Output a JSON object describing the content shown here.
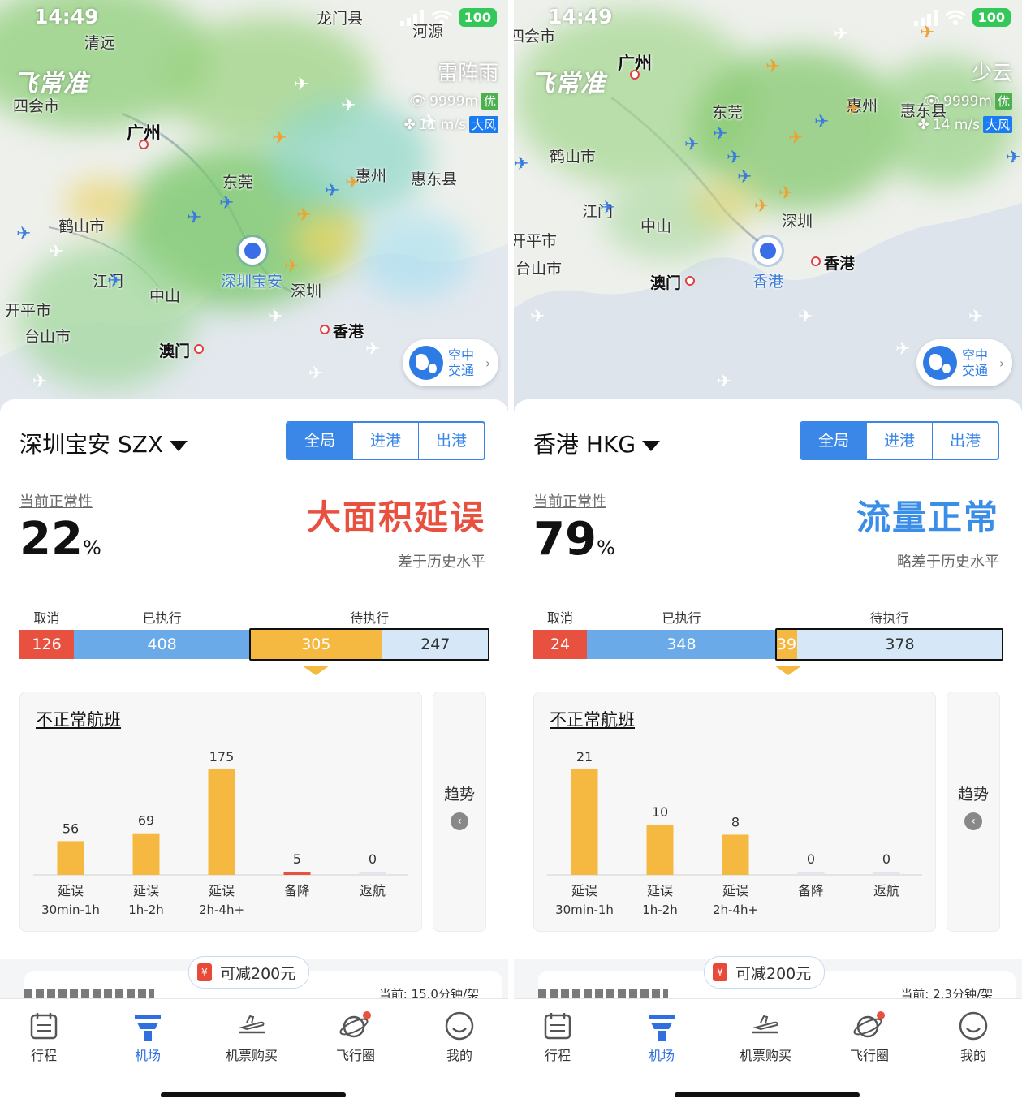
{
  "screens": [
    {
      "status": {
        "time": "14:49",
        "battery": "100"
      },
      "map": {
        "brand": "飞常准",
        "weather": {
          "condition": "雷阵雨",
          "visibility": "9999m",
          "visibility_tag": "优",
          "wind": "11 m/s",
          "wind_tag": "大风"
        },
        "cities": [
          "清远",
          "龙门县",
          "河源",
          "四会市",
          "广州",
          "东莞",
          "惠州",
          "惠东县",
          "鹤山市",
          "深圳宝安",
          "深圳",
          "江门",
          "中山",
          "开平市",
          "台山市",
          "澳门",
          "香港"
        ],
        "air_traffic_button": "空中交通"
      },
      "airport": {
        "name": "深圳宝安 SZX"
      },
      "segments": [
        "全局",
        "进港",
        "出港"
      ],
      "ontime": {
        "label": "当前正常性",
        "value": "22",
        "unit": "%"
      },
      "status_text": "大面积延误",
      "status_color": "#e8503f",
      "status_sub": "差于历史水平",
      "flow": {
        "labels": {
          "cancel": "取消",
          "done": "已执行",
          "pending": "待执行"
        },
        "values": {
          "cancel": 126,
          "done": 408,
          "pending_delayed": 305,
          "pending_normal": 247
        },
        "display": {
          "cancel": "126",
          "done": "408",
          "pending_delayed": "305",
          "pending_normal": "247"
        }
      },
      "irregular": {
        "title": "不正常航班",
        "trend": "趋势",
        "chart_data": {
          "type": "bar",
          "categories": [
            "延误 30min-1h",
            "延误 1h-2h",
            "延误 2h-4h+",
            "备降",
            "返航"
          ],
          "cat_line1": [
            "延误",
            "延误",
            "延误",
            "备降",
            "返航"
          ],
          "cat_line2": [
            "30min-1h",
            "1h-2h",
            "2h-4h+",
            "",
            ""
          ],
          "values": [
            56,
            69,
            175,
            5,
            0
          ],
          "labels": [
            "56",
            "69",
            "175",
            "5",
            "0"
          ],
          "colors": [
            "#f5b841",
            "#f5b841",
            "#f5b841",
            "#e8503f",
            "#e2e6ec"
          ]
        }
      },
      "coupon": "可减200元",
      "strip_right": "当前: 15.0分钟/架",
      "tabs": [
        "行程",
        "机场",
        "机票购买",
        "飞行圈",
        "我的"
      ]
    },
    {
      "status": {
        "time": "14:49",
        "battery": "100"
      },
      "map": {
        "brand": "飞常准",
        "weather": {
          "condition": "少云",
          "visibility": "9999m",
          "visibility_tag": "优",
          "wind": "14 m/s",
          "wind_tag": "大风"
        },
        "cities": [
          "四会市",
          "广州",
          "东莞",
          "惠州",
          "惠东县",
          "鹤山市",
          "江门",
          "中山",
          "深圳",
          "开平市",
          "台山市",
          "澳门",
          "香港",
          "香港"
        ],
        "air_traffic_button": "空中交通"
      },
      "airport": {
        "name": "香港 HKG"
      },
      "segments": [
        "全局",
        "进港",
        "出港"
      ],
      "ontime": {
        "label": "当前正常性",
        "value": "79",
        "unit": "%"
      },
      "status_text": "流量正常",
      "status_color": "#3a8ee8",
      "status_sub": "略差于历史水平",
      "flow": {
        "labels": {
          "cancel": "取消",
          "done": "已执行",
          "pending": "待执行"
        },
        "values": {
          "cancel": 24,
          "done": 348,
          "pending_delayed": 39,
          "pending_normal": 378
        },
        "display": {
          "cancel": "24",
          "done": "348",
          "pending_delayed": "39",
          "pending_normal": "378"
        }
      },
      "irregular": {
        "title": "不正常航班",
        "trend": "趋势",
        "chart_data": {
          "type": "bar",
          "categories": [
            "延误 30min-1h",
            "延误 1h-2h",
            "延误 2h-4h+",
            "备降",
            "返航"
          ],
          "cat_line1": [
            "延误",
            "延误",
            "延误",
            "备降",
            "返航"
          ],
          "cat_line2": [
            "30min-1h",
            "1h-2h",
            "2h-4h+",
            "",
            ""
          ],
          "values": [
            21,
            10,
            8,
            0,
            0
          ],
          "labels": [
            "21",
            "10",
            "8",
            "0",
            "0"
          ],
          "colors": [
            "#f5b841",
            "#f5b841",
            "#f5b841",
            "#e2e6ec",
            "#e2e6ec"
          ]
        }
      },
      "coupon": "可减200元",
      "strip_right": "当前: 2.3分钟/架",
      "tabs": [
        "行程",
        "机场",
        "机票购买",
        "飞行圈",
        "我的"
      ]
    }
  ]
}
